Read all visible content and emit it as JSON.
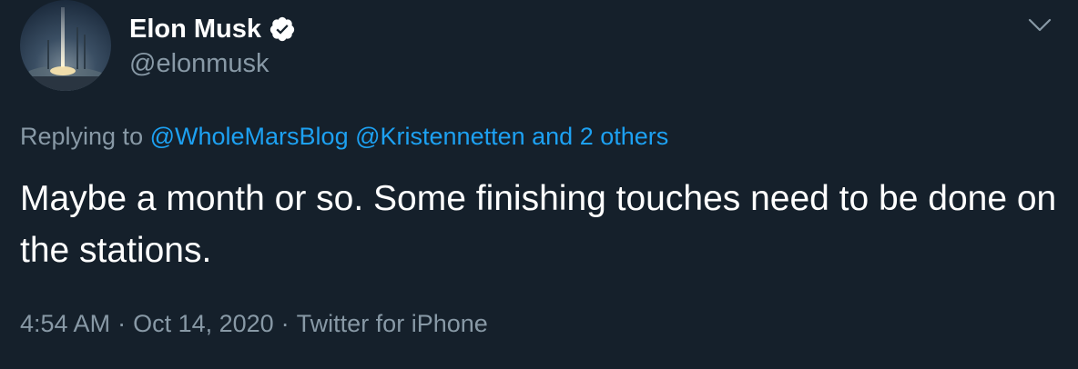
{
  "author": {
    "display_name": "Elon Musk",
    "handle": "@elonmusk",
    "verified_icon": "verified-badge-icon"
  },
  "reply": {
    "prefix": "Replying to",
    "mentions": [
      "@WholeMarsBlog",
      "@Kristennetten"
    ],
    "others": "and 2 others"
  },
  "tweet": {
    "text": "Maybe a month or so. Some finishing touches need to be done on the stations."
  },
  "meta": {
    "time": "4:54 AM",
    "date": "Oct 14, 2020",
    "source": "Twitter for iPhone"
  },
  "colors": {
    "background": "#15202b",
    "text": "#ffffff",
    "secondary": "#8899a6",
    "accent": "#1da1f2"
  },
  "icons": {
    "menu": "chevron-down-icon",
    "avatar": "rocket-launch-photo"
  }
}
